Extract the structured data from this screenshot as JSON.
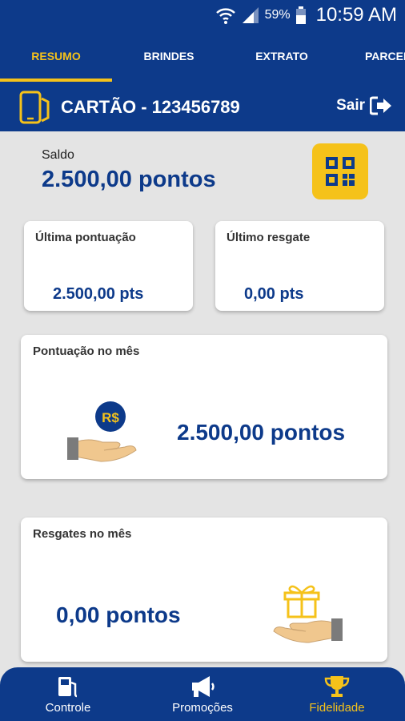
{
  "status_bar": {
    "battery": "59%",
    "time": "10:59 AM"
  },
  "tabs": [
    {
      "label": "RESUMO",
      "active": true
    },
    {
      "label": "BRINDES",
      "active": false
    },
    {
      "label": "EXTRATO",
      "active": false
    },
    {
      "label": "PARCEIR",
      "active": false
    }
  ],
  "card_header": {
    "title": "CARTÃO - 123456789",
    "logout_label": "Sair"
  },
  "balance": {
    "label": "Saldo",
    "value": "2.500,00 pontos"
  },
  "last_points": {
    "label": "Última pontuação",
    "value": "2.500,00 pts"
  },
  "last_redemption": {
    "label": "Último resgate",
    "value": "0,00 pts"
  },
  "month_points": {
    "label": "Pontuação no mês",
    "value": "2.500,00 pontos",
    "coin_text": "R$"
  },
  "month_redemptions": {
    "label": "Resgates no mês",
    "value": "0,00 pontos"
  },
  "bottom_nav": [
    {
      "label": "Controle",
      "icon": "fuel-pump-icon",
      "active": false
    },
    {
      "label": "Promoções",
      "icon": "megaphone-icon",
      "active": false
    },
    {
      "label": "Fidelidade",
      "icon": "trophy-icon",
      "active": true
    }
  ],
  "colors": {
    "primary": "#0d3a8a",
    "accent": "#f5c21a",
    "background": "#e4e4e4"
  }
}
